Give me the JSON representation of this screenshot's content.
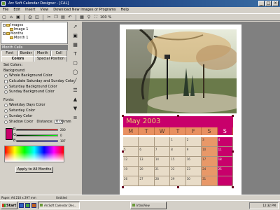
{
  "window": {
    "title": "Arc Soft Calendar Designer - [CAL]"
  },
  "menu": [
    "File",
    "Edit",
    "Insert",
    "View",
    "Download New Images or Programs",
    "Help"
  ],
  "toolbar": {
    "zoom": "100",
    "percent": "%"
  },
  "tree": {
    "images": "Images",
    "image1": "Image 1",
    "months": "Months",
    "month1": "Month 1"
  },
  "panel": {
    "header": "Month Cells",
    "tabs_top": [
      "Font",
      "Border",
      "Month",
      "Cell"
    ],
    "tabs_bottom": [
      "Colors",
      "Special Position"
    ],
    "set_colors": "Set Colors:",
    "background": "Background:",
    "bg_options": [
      "Whole Background Color",
      "Calculate Saturday and Sunday Color",
      "Saturday Background Color",
      "Sunday Background Color"
    ],
    "font": "Fonts:",
    "font_options": [
      "Weekday Days Color",
      "Saturday Color",
      "Sunday Color",
      "Shadow Color"
    ],
    "distance_label": "Distance:",
    "distance_value": "0.00",
    "distance_unit": "mm",
    "swatch_color": "#c8006b",
    "sliders": [
      {
        "label": "R",
        "value": "200"
      },
      {
        "label": "G",
        "value": "0"
      },
      {
        "label": "B",
        "value": "107"
      }
    ],
    "apply_button": "Apply to All Months"
  },
  "calendar": {
    "month_title": "May 2003",
    "day_names": [
      "M",
      "T",
      "W",
      "T",
      "F",
      "S",
      "S"
    ],
    "weeks": [
      [
        "",
        "",
        "",
        "1",
        "2",
        "3",
        "4"
      ],
      [
        "5",
        "6",
        "7",
        "8",
        "9",
        "10",
        "11"
      ],
      [
        "12",
        "13",
        "14",
        "15",
        "16",
        "17",
        "18"
      ],
      [
        "19",
        "20",
        "21",
        "22",
        "23",
        "24",
        "25"
      ],
      [
        "26",
        "27",
        "28",
        "29",
        "30",
        "31",
        ""
      ]
    ],
    "header_color": "#c8006b",
    "dayname_color": "#e89060",
    "cell_color": "#e8dcc8",
    "saturday_color": "#e89868",
    "sunday_color": "#c8006b"
  },
  "status": {
    "paper": "Paper: A4  210 x 297 mm",
    "doc": "Untitled"
  },
  "taskbar": {
    "start": "Start",
    "tasks": [
      "ArcSoft Calendar Des...",
      "IrfanView"
    ],
    "clock": "12:32 PM"
  }
}
